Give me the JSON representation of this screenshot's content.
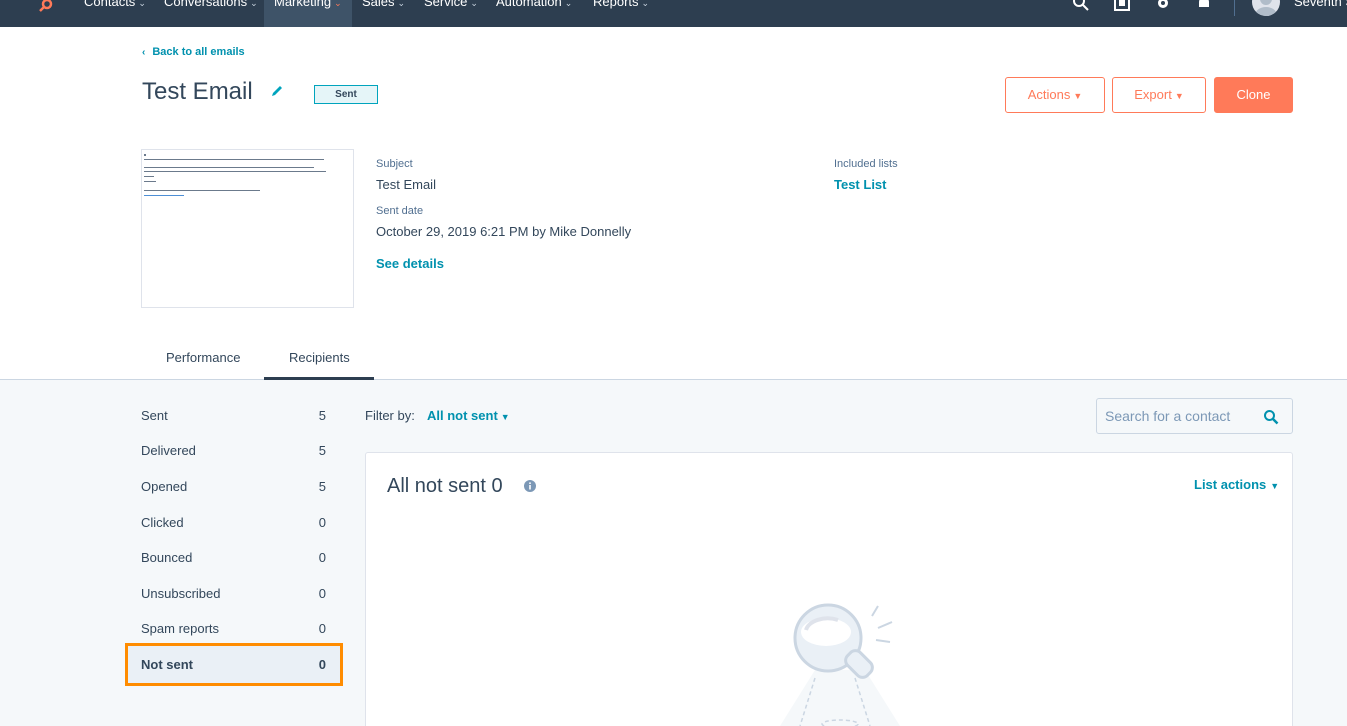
{
  "nav": {
    "items": [
      "Contacts",
      "Conversations",
      "Marketing",
      "Sales",
      "Service",
      "Automation",
      "Reports"
    ],
    "active": "Marketing",
    "user_name": "Seventh S",
    "colors": {
      "bg": "#2d3e50",
      "accent": "#ff7a59"
    },
    "icons": [
      "search-icon",
      "marketplace-icon",
      "gear-icon",
      "bell-icon"
    ]
  },
  "header": {
    "back_link": "Back to all emails",
    "title": "Test Email",
    "status_badge": "Sent",
    "actions_label": "Actions",
    "export_label": "Export",
    "clone_label": "Clone"
  },
  "details": {
    "subject_label": "Subject",
    "subject_value": "Test Email",
    "sent_date_label": "Sent date",
    "sent_date_value": "October 29, 2019 6:21 PM by Mike Donnelly",
    "see_details": "See details",
    "included_lists_label": "Included lists",
    "included_list_value": "Test List"
  },
  "tabs": {
    "performance": "Performance",
    "recipients": "Recipients",
    "active": "Recipients"
  },
  "stats": [
    {
      "label": "Sent",
      "count": "5"
    },
    {
      "label": "Delivered",
      "count": "5"
    },
    {
      "label": "Opened",
      "count": "5"
    },
    {
      "label": "Clicked",
      "count": "0"
    },
    {
      "label": "Bounced",
      "count": "0"
    },
    {
      "label": "Unsubscribed",
      "count": "0"
    },
    {
      "label": "Spam reports",
      "count": "0"
    },
    {
      "label": "Not sent",
      "count": "0"
    }
  ],
  "filter": {
    "label": "Filter by:",
    "value": "All not sent"
  },
  "search": {
    "placeholder": "Search for a contact"
  },
  "panel": {
    "title": "All not sent 0",
    "list_actions": "List actions"
  }
}
